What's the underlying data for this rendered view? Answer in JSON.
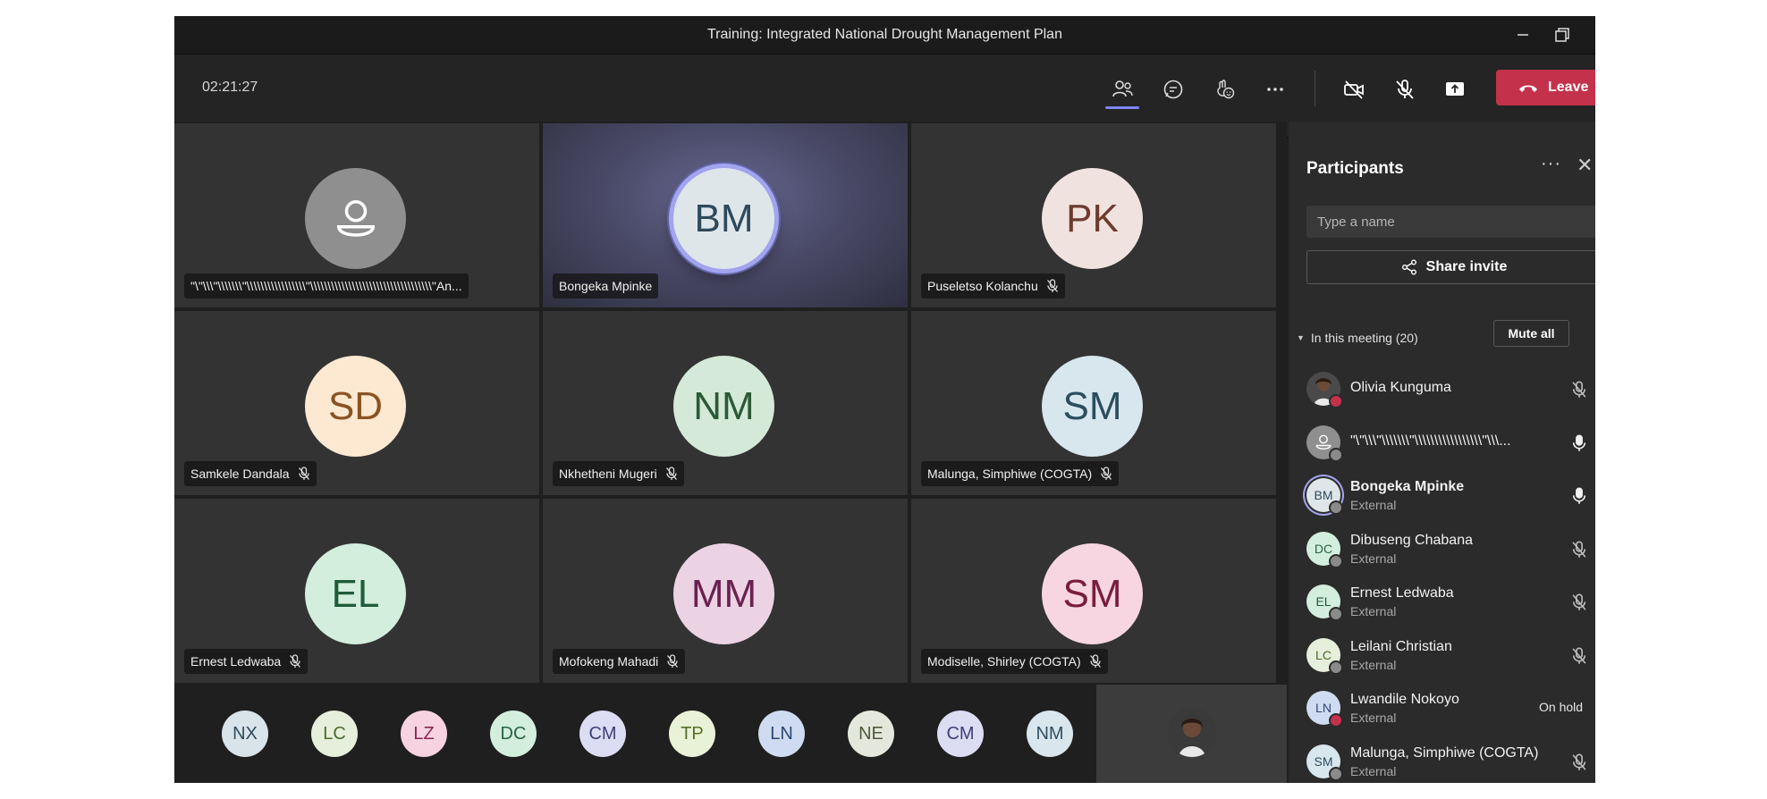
{
  "window": {
    "title": "Training: Integrated National Drought Management Plan"
  },
  "toolbar": {
    "timer": "02:21:27",
    "icons": [
      "people-icon",
      "chat-icon",
      "reactions-icon",
      "more-icon",
      "camera-off-icon",
      "mic-off-icon",
      "share-screen-icon"
    ],
    "leave_label": "Leave",
    "leave_color": "#c4314b",
    "accent": "#7f85f5"
  },
  "grid": {
    "tiles": [
      {
        "name": "\"\\\"\\\\\\\"\\\\\\\\\\\\\\\"\\\\\\\\\\\\\\\\\\\\\\\\\\\\\\\\\\\"\\\\\\\\\\\\\\\\\\\\\\\\\\\\\\\\\\\\\\\\\\\\\\\\\\\\\\\\\\\\\\\\\\\\\\\"An...",
        "initials": "",
        "color": "#8f8f8f",
        "text_color": "#ffffff",
        "muted": false,
        "placeholder": true
      },
      {
        "name": "Bongeka Mpinke",
        "initials": "BM",
        "color": "#dfe6ea",
        "text_color": "#2e4a5c",
        "muted": false,
        "speaking": true
      },
      {
        "name": "Puseletso Kolanchu",
        "initials": "PK",
        "color": "#f0e3df",
        "text_color": "#6e3b2d",
        "muted": true
      },
      {
        "name": "Samkele Dandala",
        "initials": "SD",
        "color": "#fde8d2",
        "text_color": "#8a5322",
        "muted": true
      },
      {
        "name": "Nkhetheni Mugeri",
        "initials": "NM",
        "color": "#d4e9d8",
        "text_color": "#2b5a36",
        "muted": true
      },
      {
        "name": "Malunga, Simphiwe (COGTA)",
        "initials": "SM",
        "color": "#d8e6ee",
        "text_color": "#2a4e5e",
        "muted": true
      },
      {
        "name": "Ernest Ledwaba",
        "initials": "EL",
        "color": "#d3eedd",
        "text_color": "#1f5c38",
        "muted": true
      },
      {
        "name": "Mofokeng Mahadi",
        "initials": "MM",
        "color": "#ecd3e4",
        "text_color": "#6a2150",
        "muted": true
      },
      {
        "name": "Modiselle, Shirley (COGTA)",
        "initials": "SM",
        "color": "#f7d6e2",
        "text_color": "#7a1c3d",
        "muted": true
      }
    ]
  },
  "strip": {
    "avatars": [
      {
        "initials": "NX",
        "color": "#d9e3ea",
        "text_color": "#2f4b5c"
      },
      {
        "initials": "LC",
        "color": "#e6efdc",
        "text_color": "#4b6b2c"
      },
      {
        "initials": "LZ",
        "color": "#f7d3e1",
        "text_color": "#8b2550"
      },
      {
        "initials": "DC",
        "color": "#d4eedd",
        "text_color": "#27643f"
      },
      {
        "initials": "CM",
        "color": "#dcdcf3",
        "text_color": "#3e3e7c"
      },
      {
        "initials": "TP",
        "color": "#e9f2d7",
        "text_color": "#56702a"
      },
      {
        "initials": "LN",
        "color": "#cfdbf0",
        "text_color": "#2c4777"
      },
      {
        "initials": "NE",
        "color": "#e4e8dc",
        "text_color": "#4f5a3c"
      },
      {
        "initials": "CM",
        "color": "#dcdcf3",
        "text_color": "#3e3e7c"
      },
      {
        "initials": "NM",
        "color": "#d9e6ee",
        "text_color": "#2f4f5f"
      }
    ]
  },
  "panel": {
    "title": "Participants",
    "more": "···",
    "close": "✕",
    "search_placeholder": "Type a name",
    "share_label": "Share invite",
    "section_label": "In this meeting (20)",
    "mute_all_label": "Mute all",
    "participants": [
      {
        "name": "Olivia Kunguma",
        "sub": "",
        "initials": "",
        "photo": true,
        "status_color": "#c4314b",
        "mic": "muted",
        "bold": false
      },
      {
        "name": "\"\\\"\\\\\\\"\\\\\\\\\\\\\\\"\\\\\\\\\\\\\\\\\\\\\\\\\\\\\\\\\\\"\\\\\\...",
        "sub": "",
        "initials": "",
        "placeholder": true,
        "status_color": "#8a8a8a",
        "mic": "on",
        "bold": false
      },
      {
        "name": "Bongeka Mpinke",
        "sub": "External",
        "initials": "BM",
        "color": "#dfe6ea",
        "text_color": "#2e4a5c",
        "status_color": "#8a8a8a",
        "mic": "on",
        "bold": true,
        "ring": true
      },
      {
        "name": "Dibuseng Chabana",
        "sub": "External",
        "initials": "DC",
        "color": "#d4eedd",
        "text_color": "#27643f",
        "status_color": "#8a8a8a",
        "mic": "muted",
        "bold": false
      },
      {
        "name": "Ernest Ledwaba",
        "sub": "External",
        "initials": "EL",
        "color": "#d3eedd",
        "text_color": "#1f5c38",
        "status_color": "#8a8a8a",
        "mic": "muted",
        "bold": false
      },
      {
        "name": "Leilani Christian",
        "sub": "External",
        "initials": "LC",
        "color": "#e6efdc",
        "text_color": "#4b6b2c",
        "status_color": "#8a8a8a",
        "mic": "muted",
        "bold": false
      },
      {
        "name": "Lwandile Nokoyo",
        "sub": "External",
        "initials": "LN",
        "color": "#cfdbf0",
        "text_color": "#2c4777",
        "status_color": "#c4314b",
        "mic": "text",
        "mic_text": "On hold",
        "bold": false
      },
      {
        "name": "Malunga, Simphiwe (COGTA)",
        "sub": "External",
        "initials": "SM",
        "color": "#d8e6ee",
        "text_color": "#2a4e5e",
        "status_color": "#8a8a8a",
        "mic": "muted",
        "bold": false
      }
    ]
  }
}
